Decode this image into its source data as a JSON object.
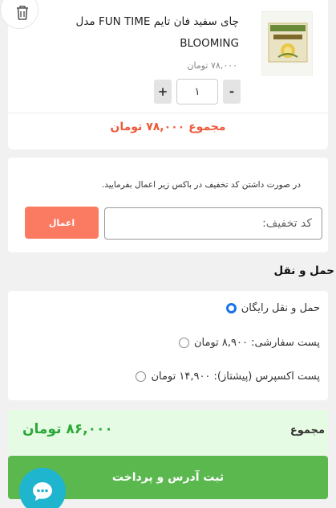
{
  "product": {
    "title": "چای سفید فان تایم FUN TIME مدل BLOOMING",
    "price": "۷۸,۰۰۰ تومان",
    "quantity": "۱",
    "plus_label": "+",
    "minus_label": "-",
    "subtotal": "مجموع ۷۸,۰۰۰ تومان"
  },
  "discount": {
    "note": "در صورت داشتن کد تخفیف در باکس زیر اعمال بفرمایید.",
    "placeholder": "کد تخفیف:",
    "apply_label": "اعمال"
  },
  "shipping": {
    "heading": "حمل و نقل",
    "options": [
      {
        "label": "حمل و نقل رایگان",
        "selected": true
      },
      {
        "label": "پست سفارشی: ۸,۹۰۰ تومان",
        "selected": false
      },
      {
        "label": "پست اکسپرس (پیشتاز): ۱۴,۹۰۰ تومان",
        "selected": false
      }
    ]
  },
  "total": {
    "label": "مجموع",
    "value": "۸۶,۰۰۰ تومان"
  },
  "checkout": {
    "label": "ثبت آدرس و پرداخت"
  },
  "colors": {
    "accent_orange": "#fb7b62",
    "subtotal_red": "#ef5a3c",
    "total_green": "#2aa838",
    "checkout_green": "#5bb84f",
    "chat_teal": "#1fb5cf"
  },
  "icons": {
    "delete": "trash-icon",
    "chat": "chat-bubble-icon",
    "product_image": "tea-box-image"
  }
}
